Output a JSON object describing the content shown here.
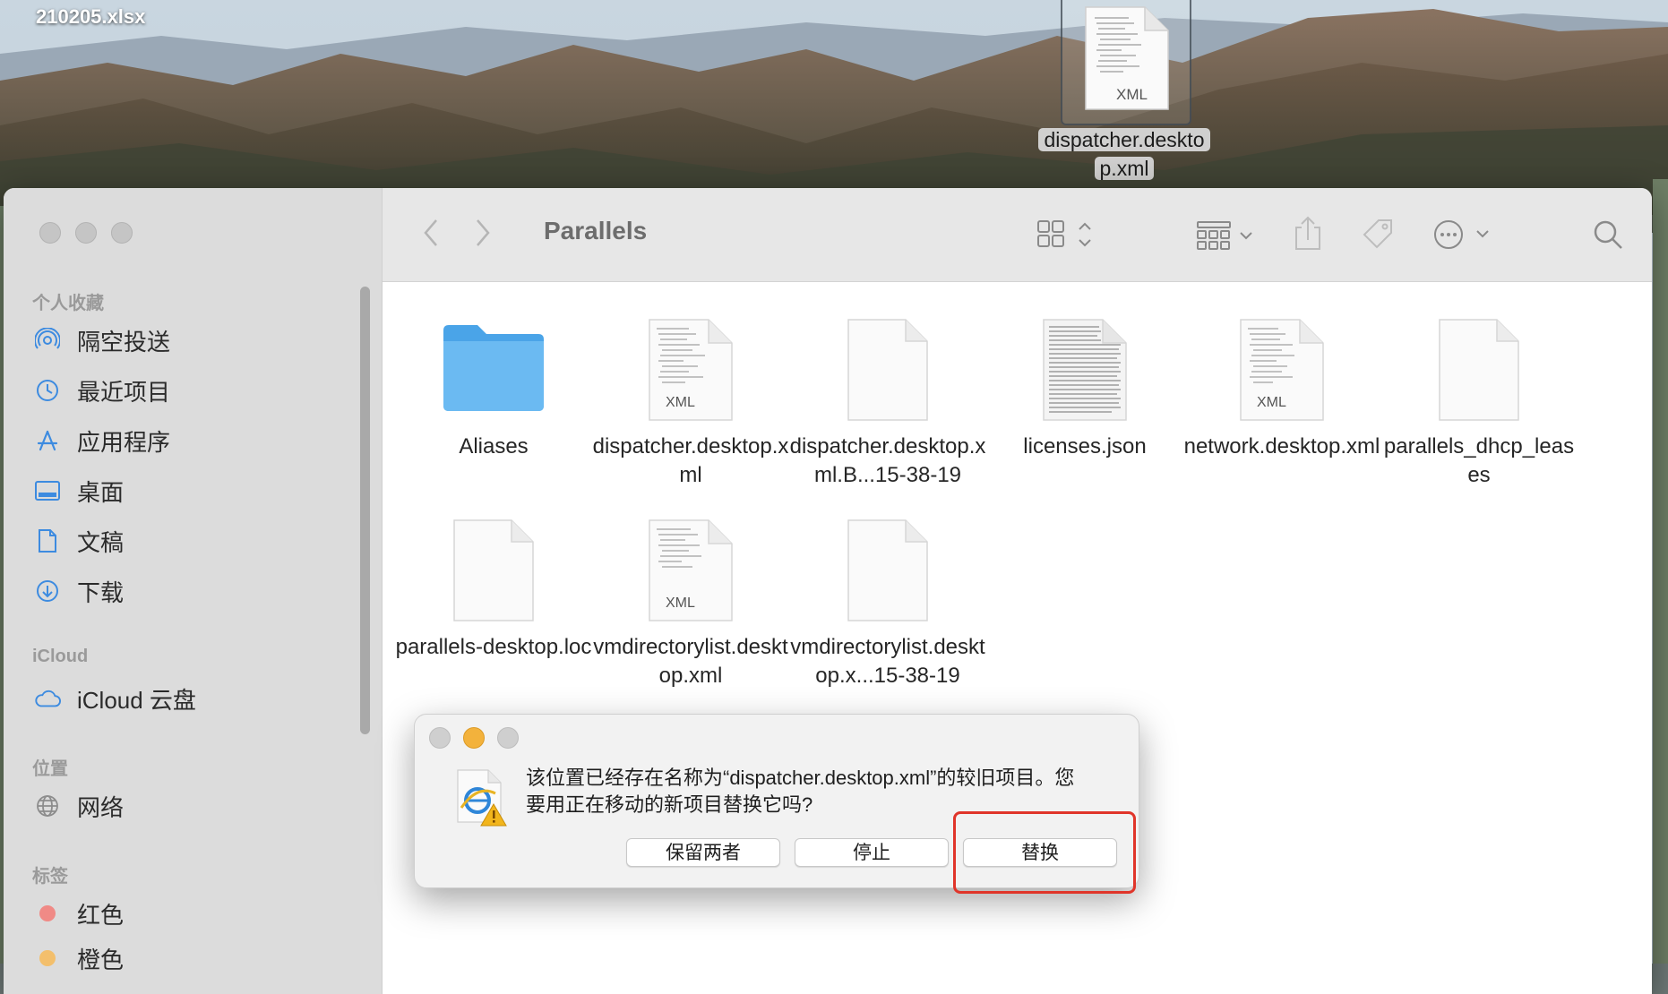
{
  "desktop": {
    "top_left_label": "210205.xlsx",
    "dragged_file": {
      "name": "dispatcher.desktop.xml",
      "badge": "XML",
      "name_line1": "dispatcher.deskto",
      "name_line2": "p.xml"
    }
  },
  "finder": {
    "title": "Parallels",
    "sidebar": {
      "favorites_heading": "个人收藏",
      "favorites": [
        {
          "label": "隔空投送",
          "icon": "airdrop-icon"
        },
        {
          "label": "最近项目",
          "icon": "clock-icon"
        },
        {
          "label": "应用程序",
          "icon": "applications-icon"
        },
        {
          "label": "桌面",
          "icon": "desktop-icon"
        },
        {
          "label": "文稿",
          "icon": "document-icon"
        },
        {
          "label": "下载",
          "icon": "download-icon"
        }
      ],
      "icloud_heading": "iCloud",
      "icloud": [
        {
          "label": "iCloud 云盘",
          "icon": "cloud-icon"
        }
      ],
      "locations_heading": "位置",
      "locations": [
        {
          "label": "网络",
          "icon": "globe-icon"
        }
      ],
      "tags_heading": "标签",
      "tags": [
        {
          "label": "红色",
          "color": "#f08a86"
        },
        {
          "label": "橙色",
          "color": "#f3bf6c"
        }
      ]
    },
    "files": [
      {
        "name": "Aliases",
        "kind": "folder"
      },
      {
        "name": "dispatcher.desktop.xml",
        "kind": "xml",
        "badge": "XML"
      },
      {
        "name": "dispatcher.desktop.xml.B...15-38-19",
        "kind": "blank"
      },
      {
        "name": "licenses.json",
        "kind": "text"
      },
      {
        "name": "network.desktop.xml",
        "kind": "xml",
        "badge": "XML"
      },
      {
        "name": "parallels_dhcp_leases",
        "kind": "blank"
      },
      {
        "name": "parallels-desktop.loc",
        "kind": "blank"
      },
      {
        "name": "vmdirectorylist.desktop.xml",
        "kind": "xml",
        "badge": "XML"
      },
      {
        "name": "vmdirectorylist.desktop.x...15-38-19",
        "kind": "blank"
      }
    ]
  },
  "dialog": {
    "message_line1": "该位置已经存在名称为“dispatcher.desktop.xml”的较旧项目。您",
    "message_line2": "要用正在移动的新项目替换它吗?",
    "keep_both_label": "保留两者",
    "stop_label": "停止",
    "replace_label": "替换"
  },
  "colors": {
    "folder_blue": "#5ab1ee",
    "highlight_red": "#e0352a",
    "traffic_yellow": "#f3b23c"
  }
}
